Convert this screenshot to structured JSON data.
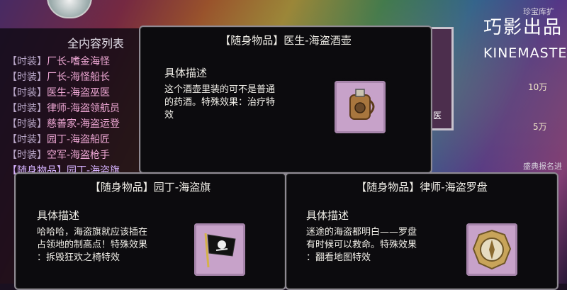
{
  "logo": {
    "cn": "巧影出品",
    "en": "KINEMASTE"
  },
  "top_right_label": "珍宝库扩",
  "bottom_right_label": "盛典报名进",
  "ticks": [
    "10万",
    "5万"
  ],
  "side_char": "医",
  "list": {
    "title": "全内容列表",
    "items": [
      {
        "tag": "【时装】",
        "name": "厂长-嗜金海怪"
      },
      {
        "tag": "【时装】",
        "name": "厂长-海怪船长"
      },
      {
        "tag": "【时装】",
        "name": "医生-海盗巫医"
      },
      {
        "tag": "【时装】",
        "name": "律师-海盗领航员"
      },
      {
        "tag": "【时装】",
        "name": "慈善家-海盗运登"
      },
      {
        "tag": "【时装】",
        "name": "园丁-海盗船匠"
      },
      {
        "tag": "【时装】",
        "name": "空军-海盗枪手"
      },
      {
        "tag": "【随身物品】",
        "name": "园丁-海盗旗"
      }
    ]
  },
  "cards": [
    {
      "title": "【随身物品】医生-海盗酒壶",
      "desc_title": "具体描述",
      "desc": [
        "这个酒壶里装的可不是普通",
        "的药酒。特殊效果：治疗特",
        "效"
      ],
      "icon": "flask-icon"
    },
    {
      "title": "【随身物品】园丁-海盗旗",
      "desc_title": "具体描述",
      "desc": [
        "哈哈哈，海盗旗就应该插在",
        "占领地的制高点！特殊效果",
        "：拆毁狂欢之椅特效"
      ],
      "icon": "pirate-flag-icon"
    },
    {
      "title": "【随身物品】律师-海盗罗盘",
      "desc_title": "具体描述",
      "desc": [
        "迷途的海盗都明白——罗盘",
        "有时候可以救命。特殊效果",
        "：翻看地图特效"
      ],
      "icon": "compass-icon"
    }
  ]
}
